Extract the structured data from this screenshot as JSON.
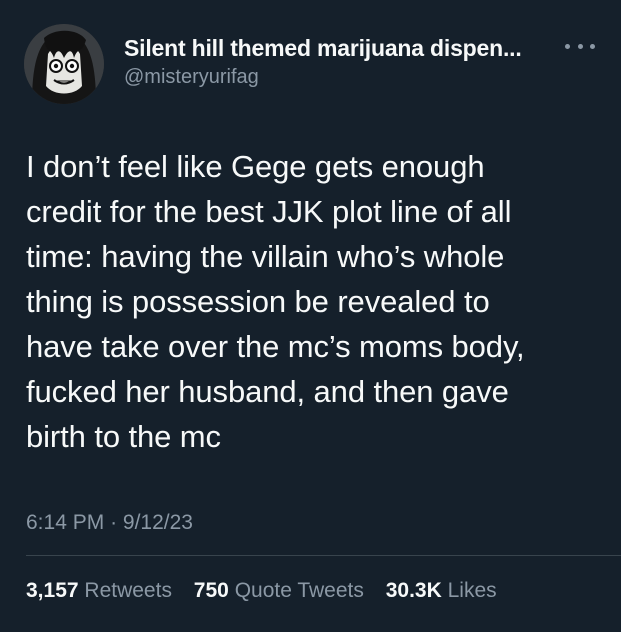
{
  "author": {
    "display_name": "Silent hill themed marijuana dispen...",
    "handle": "@misteryurifag"
  },
  "tweet": {
    "text": "I don’t feel like Gege gets enough\ncredit for the best JJK plot line of all\ntime: having the villain who’s whole\nthing is possession be revealed to\nhave take over the mc’s moms body,\nfucked her husband, and then gave\nbirth to the mc",
    "time": "6:14 PM",
    "separator": "·",
    "date": "9/12/23"
  },
  "stats": {
    "retweets_count": "3,157",
    "retweets_label": "Retweets",
    "quotes_count": "750",
    "quotes_label": "Quote Tweets",
    "likes_count": "30.3K",
    "likes_label": "Likes"
  },
  "icons": {
    "avatar": "avatar-image",
    "more": "more-options-icon"
  },
  "colors": {
    "background": "#15202b",
    "text_primary": "#f7f9f9",
    "text_secondary": "#8b98a5",
    "divider": "#38444d"
  }
}
